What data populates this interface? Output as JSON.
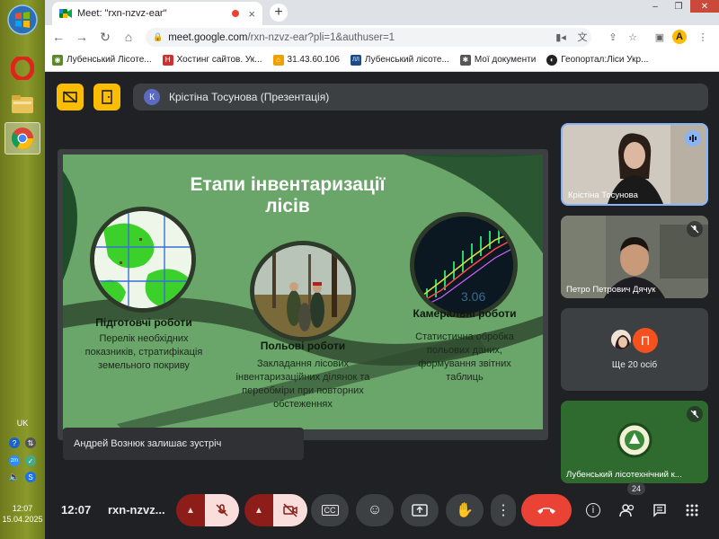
{
  "browser": {
    "tab_title": "Meet: \"rxn-nzvz-ear\"",
    "url_host": "meet.google.com",
    "url_path": "/rxn-nzvz-ear?pli=1&authuser=1",
    "bookmarks": [
      {
        "label": "Лубенський Лісоте...",
        "icon": "forest-seal-icon"
      },
      {
        "label": "Хостинг сайтов. Ук...",
        "icon": "hosting-icon"
      },
      {
        "label": "31.43.60.106",
        "icon": "server-icon"
      },
      {
        "label": "Лубенський лісоте...",
        "icon": "school-icon"
      },
      {
        "label": "Мої документи",
        "icon": "documents-icon"
      },
      {
        "label": "Геопортал:Ліси Укр...",
        "icon": "geoportal-icon"
      }
    ]
  },
  "meet": {
    "presenter_initial": "К",
    "presenter_label": "Крістіна Тосунова (Презентація)",
    "clock": "12:07",
    "meeting_code": "rxn-nzvz...",
    "participants_count": "24",
    "toast": "Андрей Вознюк залишає зустріч",
    "tiles": [
      {
        "name": "Крістіна Тосунова"
      },
      {
        "name": "Петро Петрович Дячук"
      },
      {
        "name": "Ще 20 осіб",
        "avatar_letter": "П"
      },
      {
        "name": "Лубенський лісотехнічний к..."
      }
    ]
  },
  "slide": {
    "title": "Етапи інвентаризації лісів",
    "sections": [
      {
        "heading": "Підготовчі роботи",
        "text": "Перелік необхідних показників, стратифікація земельного покриву"
      },
      {
        "heading": "Польові роботи",
        "text": "Закладання лісових інвентаризаційних ділянок та переобміри при повторних обстеженнях"
      },
      {
        "heading": "Камеральні роботи",
        "text": "Статистична обробка польових даних, формування звітних таблиць"
      }
    ]
  },
  "taskbar": {
    "lang": "UK",
    "time": "12:07",
    "date": "15.04.2025"
  },
  "colors": {
    "meet_bg": "#202124",
    "slide_green": "#6aa56a",
    "end_call": "#ea4335",
    "accent_yellow": "#fbbc04"
  }
}
